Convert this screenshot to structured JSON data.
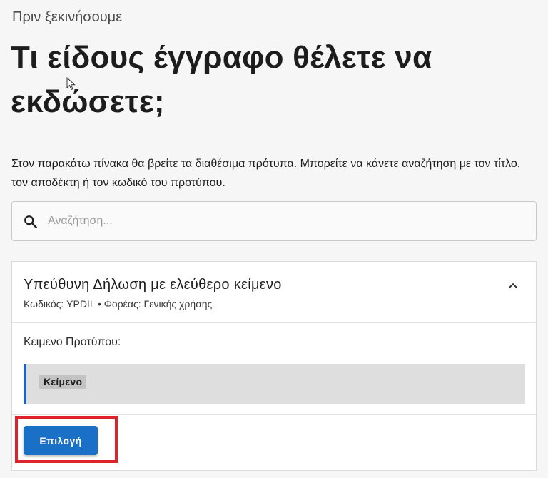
{
  "header": {
    "pre_title": "Πριν ξεκινήσουμε",
    "title": "Τι είδους έγγραφο θέλετε να εκδώσετε;",
    "description": "Στον παρακάτω πίνακα θα βρείτε τα διαθέσιμα πρότυπα. Μπορείτε να κάνετε αναζήτηση με τον τίτλο, τον αποδέκτη ή τον κωδικό του προτύπου."
  },
  "search": {
    "placeholder": "Αναζήτηση...",
    "value": "",
    "icon": "search-icon"
  },
  "template_card": {
    "title": "Υπεύθυνη Δήλωση με ελεύθερο κείμενο",
    "meta": "Κωδικός: YPDIL • Φορέας: Γενικής χρήσης",
    "expanded_icon": "chevron-up-icon",
    "template_text_label": "Κειμενο Προτύπου:",
    "template_tag": "Κείμενο",
    "select_label": "Επιλογή"
  },
  "colors": {
    "primary_button": "#1a6fc6",
    "accent_border": "#1f63bd",
    "highlight": "#e0222c"
  }
}
